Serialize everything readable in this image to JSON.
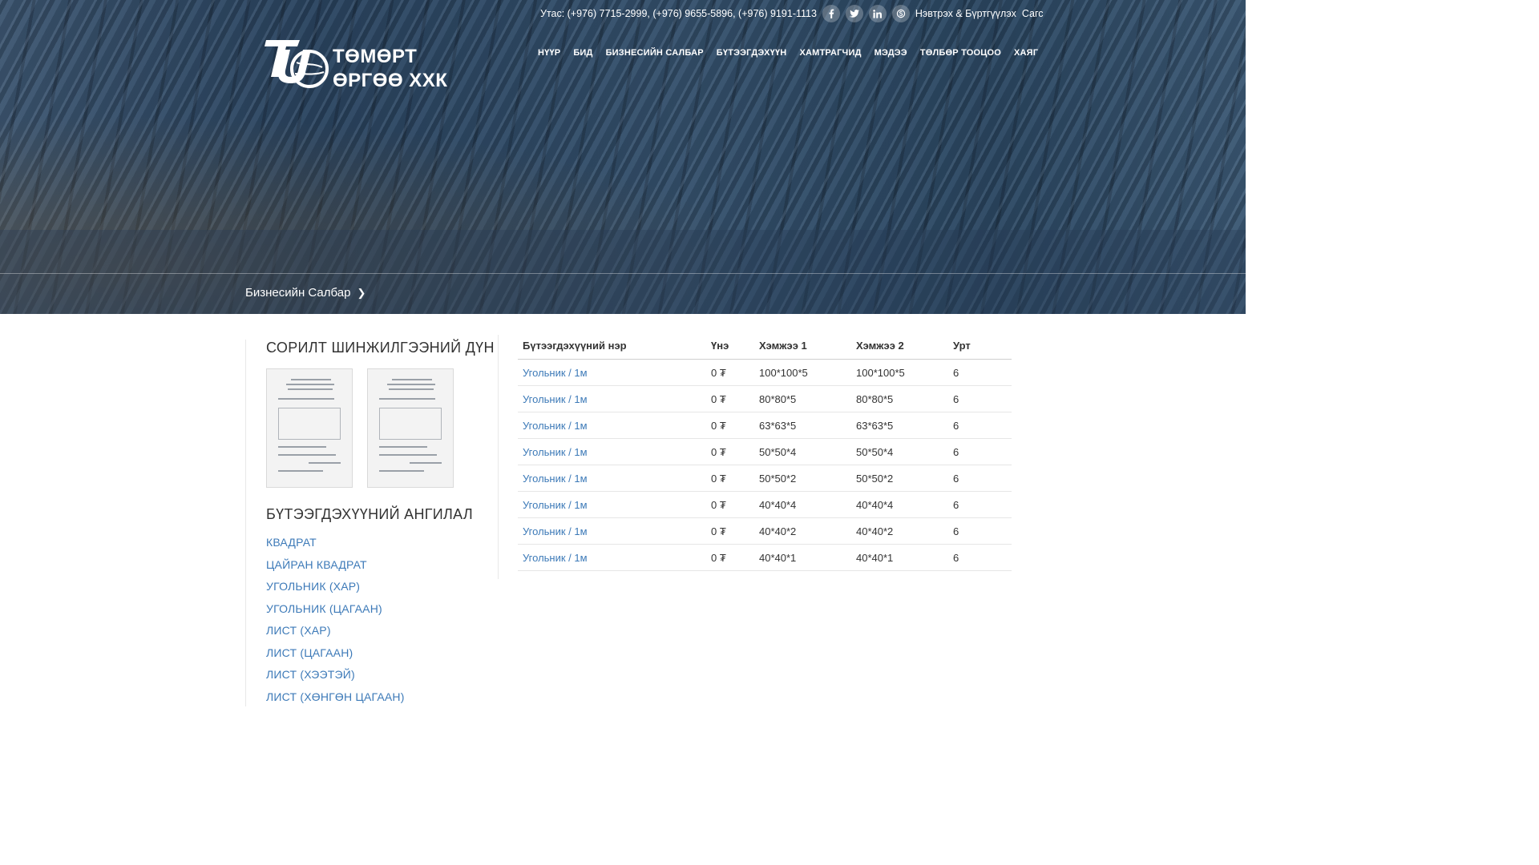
{
  "topbar": {
    "phone": "Утас: (+976) 7715-2999, (+976) 9655-5896, (+976) 9191-1113",
    "social_icons": [
      "facebook-icon",
      "twitter-icon",
      "linkedin-icon",
      "skype-icon"
    ],
    "auth": "Нэвтрэх & Бүртгүүлэх",
    "cart": "Сагс"
  },
  "logo": {
    "line1": "ТӨМӨРТ",
    "line2": "ӨРГӨӨ ХХК"
  },
  "nav": {
    "items": [
      "НҮҮР",
      "БИД",
      "БИЗНЕСИЙН САЛБАР",
      "БҮТЭЭГДЭХҮҮН",
      "ХАМТРАГЧИД",
      "МЭДЭЭ",
      "ТӨЛБӨР ТООЦОО",
      "ХАЯГ"
    ]
  },
  "breadcrumb": {
    "label": "Бизнесийн Салбар"
  },
  "sidebar": {
    "test_results_title": "СОРИЛТ ШИНЖИЛГЭЭНИЙ ДҮН",
    "categories_title": "БҮТЭЭГДЭХҮҮНИЙ АНГИЛАЛ",
    "categories": [
      "КВАДРАТ",
      "ЦАЙРАН КВАДРАТ",
      "УГОЛЬНИК (ХАР)",
      "УГОЛЬНИК (ЦАГААН)",
      "ЛИСТ (ХАР)",
      "ЛИСТ (ЦАГААН)",
      "ЛИСТ (ХЭЭТЭЙ)",
      "ЛИСТ (ХӨНГӨН ЦАГААН)"
    ]
  },
  "products": {
    "headers": [
      "Бүтээгдэхүүний нэр",
      "Үнэ",
      "Хэмжээ 1",
      "Хэмжээ 2",
      "Урт"
    ],
    "rows": [
      [
        "Угольник / 1м",
        "0 ₮",
        "100*100*5",
        "100*100*5",
        "6"
      ],
      [
        "Угольник / 1м",
        "0 ₮",
        "80*80*5",
        "80*80*5",
        "6"
      ],
      [
        "Угольник / 1м",
        "0 ₮",
        "63*63*5",
        "63*63*5",
        "6"
      ],
      [
        "Угольник / 1м",
        "0 ₮",
        "50*50*4",
        "50*50*4",
        "6"
      ],
      [
        "Угольник / 1м",
        "0 ₮",
        "50*50*2",
        "50*50*2",
        "6"
      ],
      [
        "Угольник / 1м",
        "0 ₮",
        "40*40*4",
        "40*40*4",
        "6"
      ],
      [
        "Угольник / 1м",
        "0 ₮",
        "40*40*2",
        "40*40*2",
        "6"
      ],
      [
        "Угольник / 1м",
        "0 ₮",
        "40*40*1",
        "40*40*1",
        "6"
      ]
    ]
  },
  "colors": {
    "link": "#3d7ab8",
    "hero": "#2f4a66",
    "text": "#333333"
  }
}
